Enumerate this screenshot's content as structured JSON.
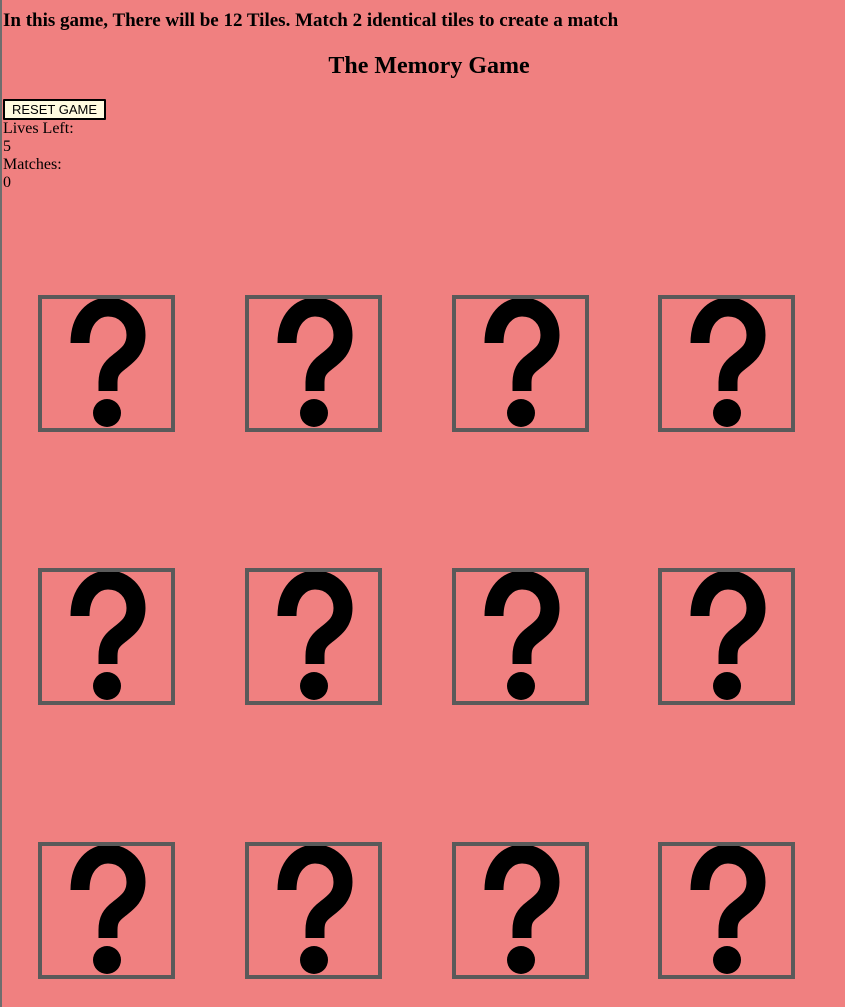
{
  "instructions": "In this game, There will be 12 Tiles. Match 2 identical tiles to create a match",
  "title": "The Memory Game",
  "reset_label": "RESET GAME",
  "lives_label": "Lives Left:",
  "lives_value": "5",
  "matches_label": "Matches:",
  "matches_value": "0",
  "tile_count": 12,
  "tile_face": "question-mark-icon",
  "colors": {
    "background": "#f08080",
    "tile_border": "#5a5a5a",
    "reset_button_bg": "#fffbe0"
  }
}
